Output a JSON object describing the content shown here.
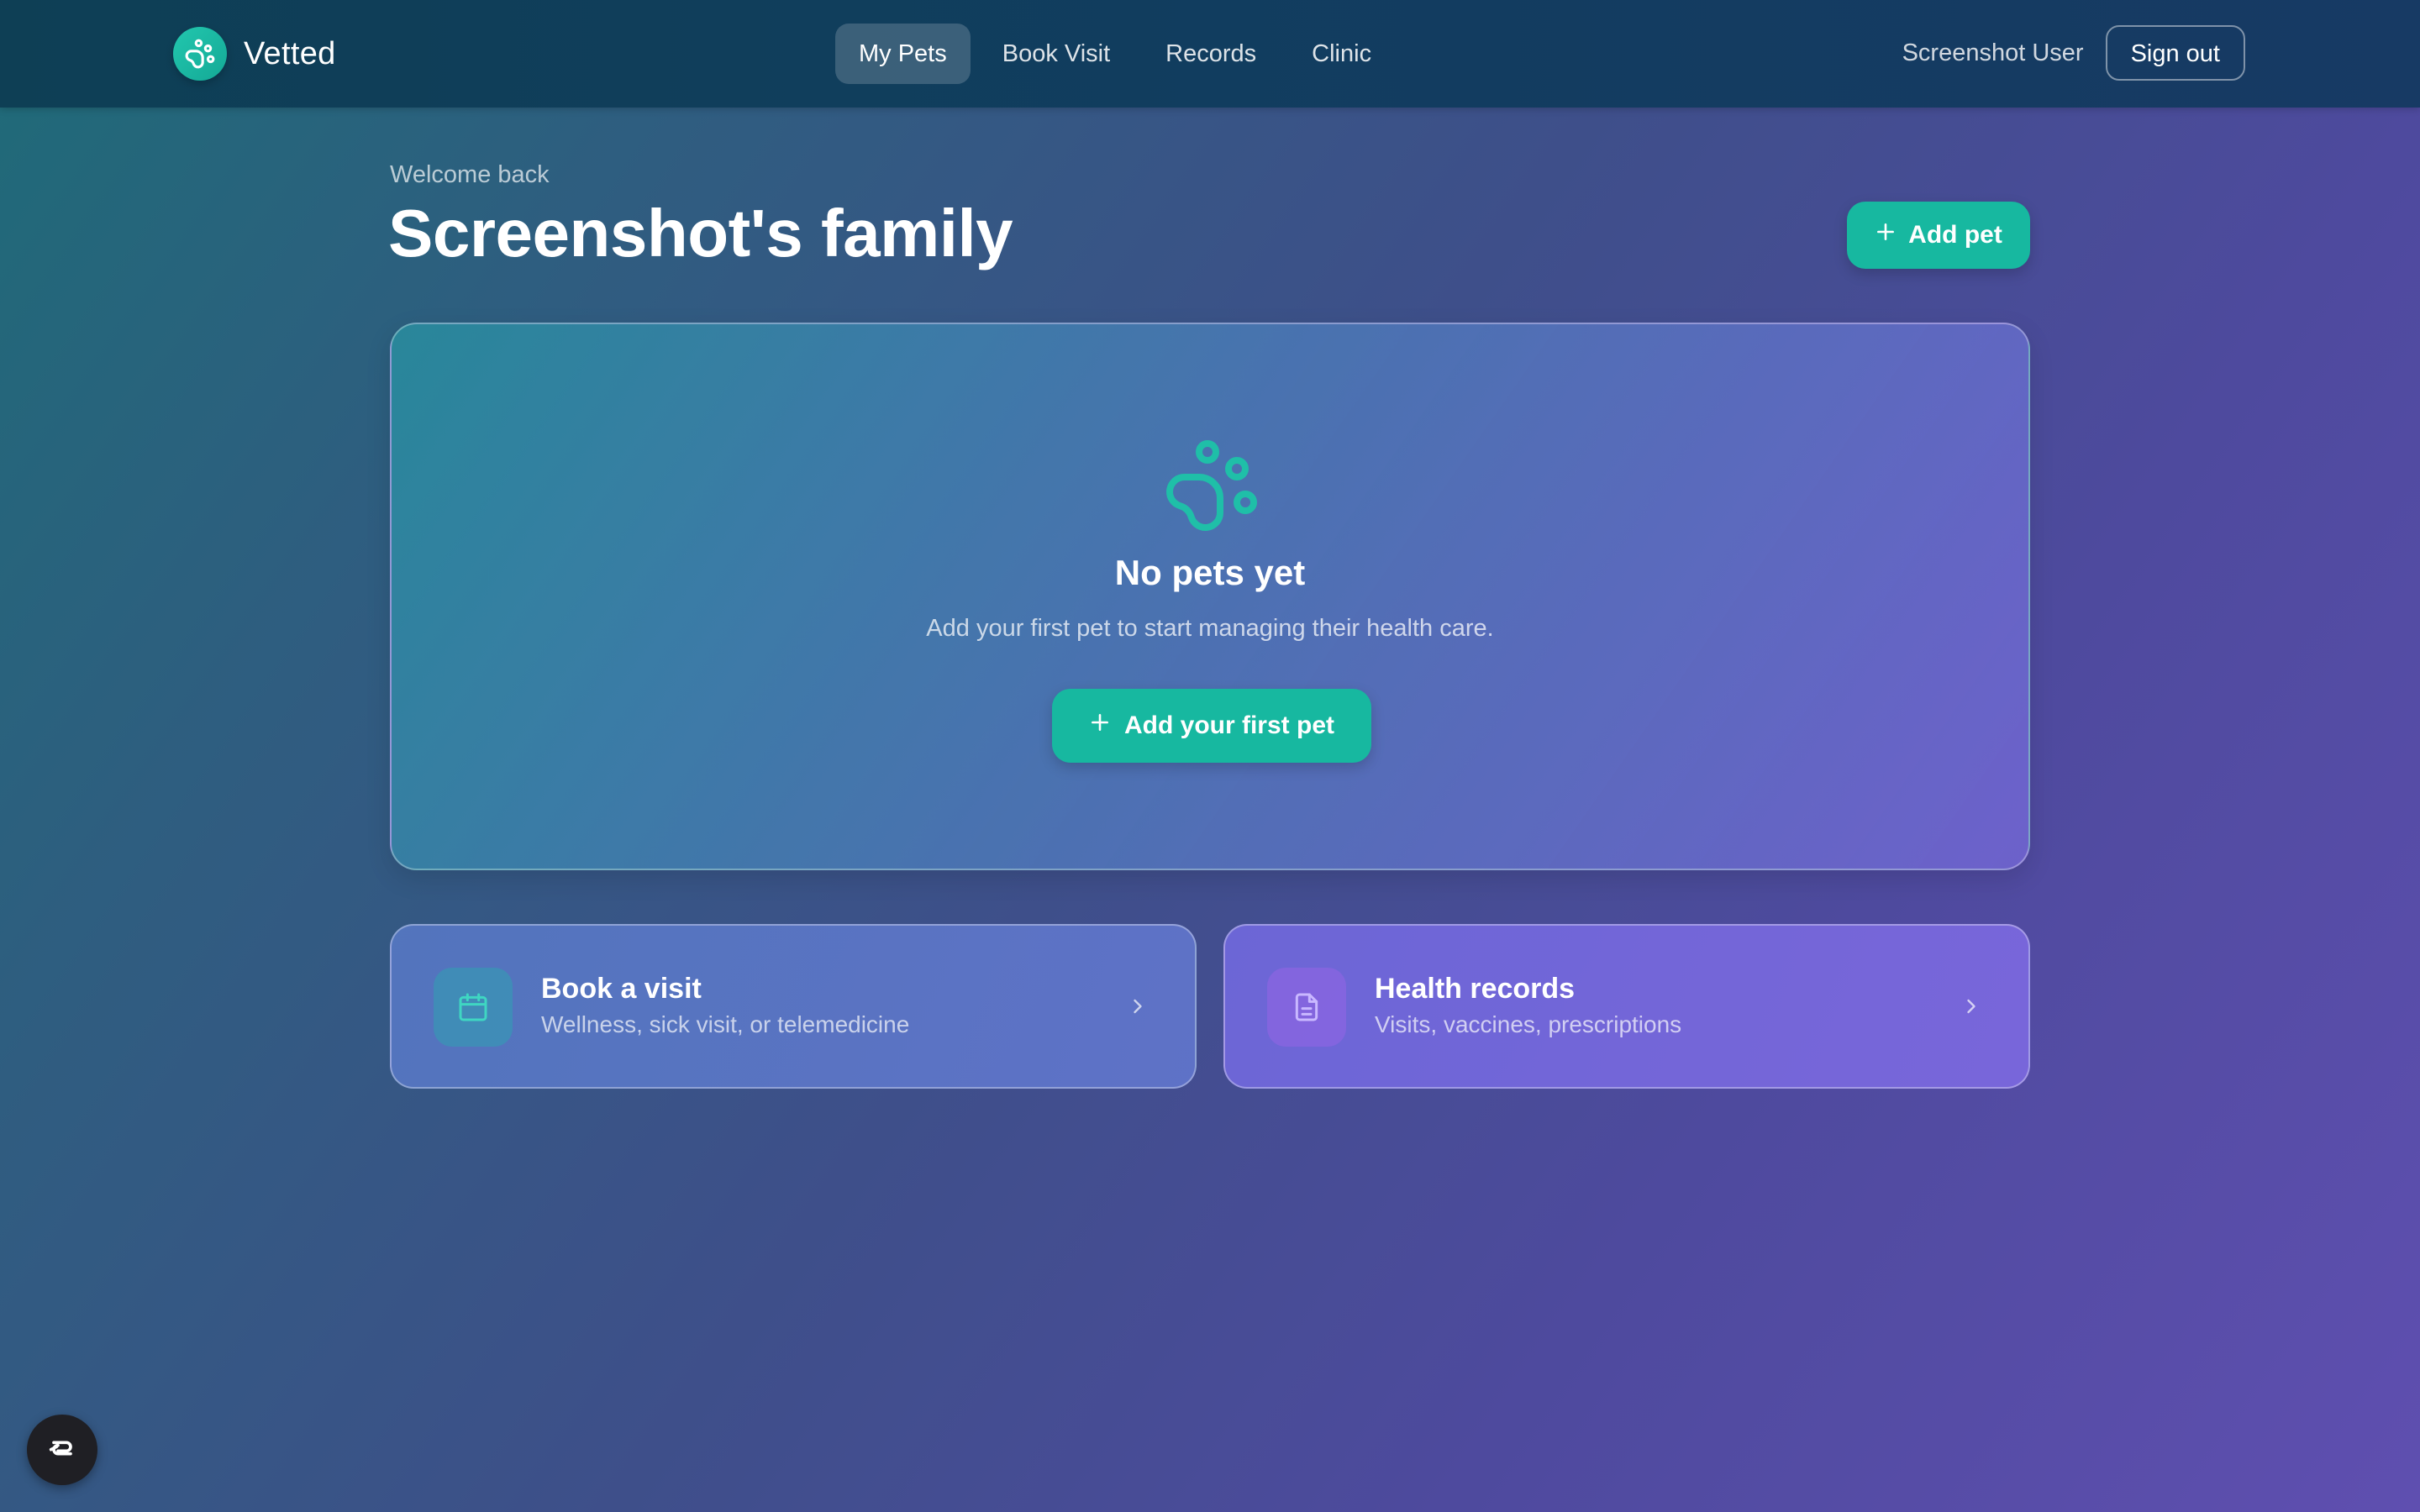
{
  "brand": {
    "name": "Vetted",
    "logo_icon": "paw-icon",
    "accent_color": "#17b8a0"
  },
  "nav": {
    "items": [
      {
        "label": "My Pets",
        "active": true
      },
      {
        "label": "Book Visit",
        "active": false
      },
      {
        "label": "Records",
        "active": false
      },
      {
        "label": "Clinic",
        "active": false
      }
    ]
  },
  "user": {
    "name": "Screenshot User",
    "signout_label": "Sign out"
  },
  "header": {
    "welcome": "Welcome back",
    "title": "Screenshot's family",
    "add_pet_label": "Add pet"
  },
  "empty_state": {
    "icon": "paw-icon",
    "title": "No pets yet",
    "subtitle": "Add your first pet to start managing their health care.",
    "cta_label": "Add your first pet"
  },
  "cards": [
    {
      "icon": "calendar-icon",
      "title": "Book a visit",
      "subtitle": "Wellness, sick visit, or telemedicine"
    },
    {
      "icon": "document-icon",
      "title": "Health records",
      "subtitle": "Visits, vaccines, prescriptions"
    }
  ],
  "fab": {
    "icon": "assistant-icon"
  }
}
